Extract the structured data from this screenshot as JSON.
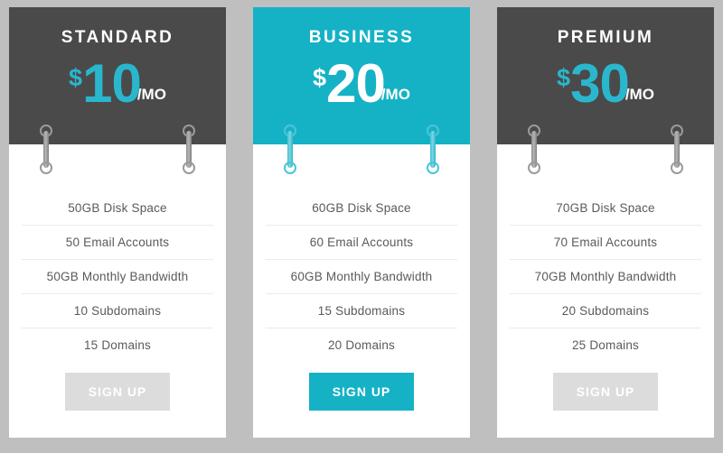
{
  "theme": {
    "page_background": "#bfbfbf",
    "card_background": "#ffffff",
    "header_dark": "#4a4a4a",
    "accent_teal": "#15b2c6",
    "price_teal": "#2ab7ce",
    "button_gray": "#dcdcdc",
    "feature_text": "#5a5a5a",
    "divider": "#ebebeb"
  },
  "plans": [
    {
      "id": "standard",
      "title": "STANDARD",
      "currency": "$",
      "amount": "10",
      "period": "/MO",
      "featured": false,
      "features": [
        "50GB Disk Space",
        "50 Email Accounts",
        "50GB Monthly Bandwidth",
        "10 Subdomains",
        "15 Domains"
      ],
      "cta_label": "SIGN UP"
    },
    {
      "id": "business",
      "title": "BUSINESS",
      "currency": "$",
      "amount": "20",
      "period": "/MO",
      "featured": true,
      "features": [
        "60GB Disk Space",
        "60 Email Accounts",
        "60GB Monthly Bandwidth",
        "15 Subdomains",
        "20 Domains"
      ],
      "cta_label": "SIGN UP"
    },
    {
      "id": "premium",
      "title": "PREMIUM",
      "currency": "$",
      "amount": "30",
      "period": "/MO",
      "featured": false,
      "features": [
        "70GB Disk Space",
        "70 Email Accounts",
        "70GB Monthly Bandwidth",
        "20 Subdomains",
        "25 Domains"
      ],
      "cta_label": "SIGN UP"
    }
  ]
}
